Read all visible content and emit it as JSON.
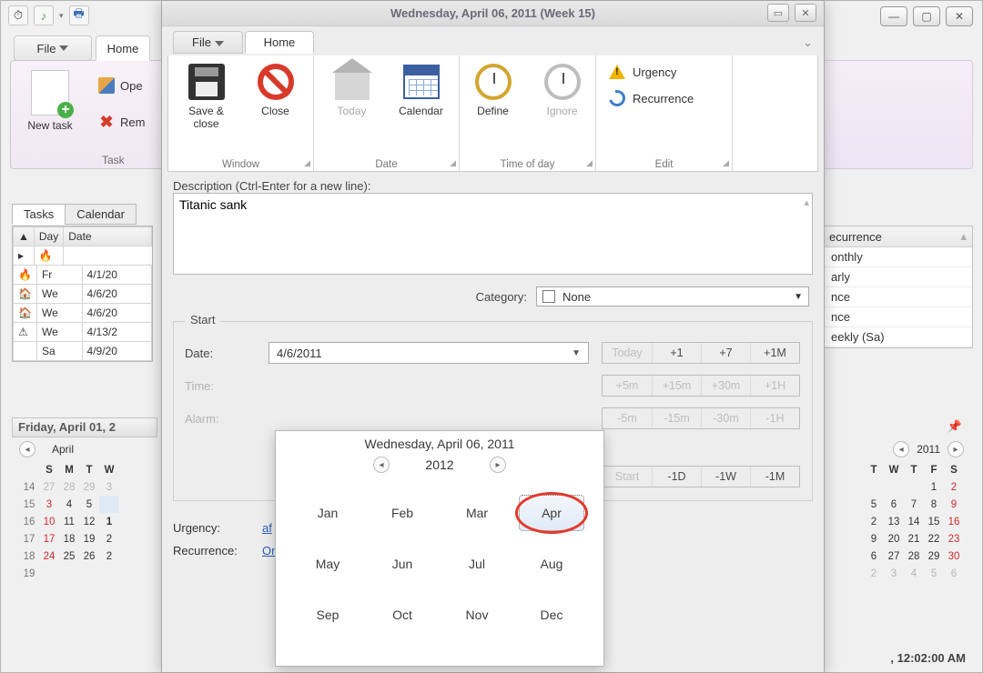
{
  "bg": {
    "file_tab": "File",
    "home_tab": "Home",
    "new_task": "New task",
    "ope": "Ope",
    "rem": "Rem",
    "task_group": "Task",
    "tabs2": {
      "tasks": "Tasks",
      "calendar": "Calendar"
    },
    "grid": {
      "headers": {
        "day": "Day",
        "date": "Date"
      },
      "rows": [
        {
          "icon": "flame",
          "day": "Fr",
          "date": "4/1/20"
        },
        {
          "icon": "house",
          "day": "We",
          "date": "4/6/20"
        },
        {
          "icon": "house",
          "day": "We",
          "date": "4/6/20"
        },
        {
          "icon": "warn",
          "day": "We",
          "date": "4/13/2"
        },
        {
          "icon": "",
          "day": "Sa",
          "date": "4/9/20"
        }
      ]
    },
    "date_header": "Friday, April 01, 2",
    "cal": {
      "month": "April",
      "dow": [
        "S",
        "M",
        "T",
        "W"
      ],
      "weeks": [
        "14",
        "15",
        "16",
        "17",
        "18",
        "19"
      ]
    },
    "right": {
      "header": "ecurrence",
      "items": [
        "onthly",
        "arly",
        "nce",
        "nce",
        "eekly (Sa)"
      ]
    },
    "right_cal": {
      "year": "2011",
      "dow": [
        "T",
        "W",
        "T",
        "F",
        "S"
      ]
    },
    "status": ", 12:02:00 AM"
  },
  "ed": {
    "title": "Wednesday, April 06, 2011 (Week 15)",
    "tabs": {
      "file": "File",
      "home": "Home"
    },
    "ribbon": {
      "save_close": "Save & close",
      "close": "Close",
      "today": "Today",
      "calendar": "Calendar",
      "define": "Define",
      "ignore": "Ignore",
      "urgency": "Urgency",
      "recurrence": "Recurrence",
      "g_window": "Window",
      "g_date": "Date",
      "g_time": "Time of day",
      "g_edit": "Edit"
    },
    "desc_label": "Description (Ctrl-Enter for a new line):",
    "desc_value": "Titanic sank",
    "category_label": "Category:",
    "category_value": "None",
    "section_start": "Start",
    "date_label": "Date:",
    "date_value": "4/6/2011",
    "quick_date": [
      "Today",
      "+1",
      "+7",
      "+1M"
    ],
    "time_label": "Time:",
    "quick_time_plus": [
      "+5m",
      "+15m",
      "+30m",
      "+1H"
    ],
    "alarm_label": "Alarm:",
    "quick_time_minus": [
      "-5m",
      "-15m",
      "-30m",
      "-1H"
    ],
    "quick_start": [
      "Start",
      "-1D",
      "-1W",
      "-1M"
    ],
    "urgency_label": "Urgency:",
    "urgency_value": "af",
    "recurrence_label": "Recurrence:",
    "recurrence_value": "On"
  },
  "picker": {
    "head": "Wednesday, April 06, 2011",
    "year": "2012",
    "months": [
      "Jan",
      "Feb",
      "Mar",
      "Apr",
      "May",
      "Jun",
      "Jul",
      "Aug",
      "Sep",
      "Oct",
      "Nov",
      "Dec"
    ],
    "selected": "Apr"
  }
}
